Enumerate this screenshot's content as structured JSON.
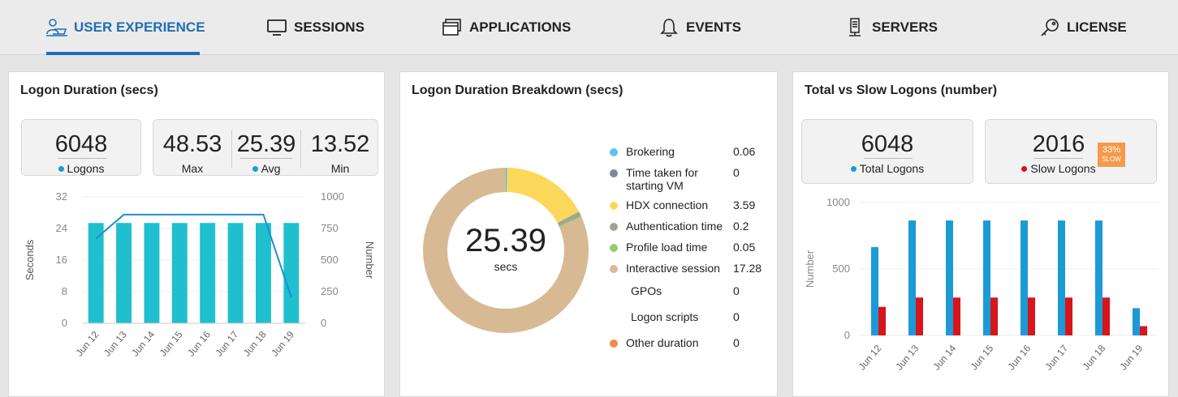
{
  "nav": {
    "tabs": [
      {
        "label": "USER EXPERIENCE",
        "icon": "user-laptop-icon",
        "active": true
      },
      {
        "label": "SESSIONS",
        "icon": "monitor-icon"
      },
      {
        "label": "APPLICATIONS",
        "icon": "windows-icon"
      },
      {
        "label": "EVENTS",
        "icon": "bell-icon"
      },
      {
        "label": "SERVERS",
        "icon": "server-icon"
      },
      {
        "label": "LICENSE",
        "icon": "key-icon"
      }
    ],
    "accent": "#1f6fb5"
  },
  "logon_duration": {
    "title": "Logon Duration (secs)",
    "logons_value": "6048",
    "logons_label": "Logons",
    "max_value": "48.53",
    "max_label": "Max",
    "avg_value": "25.39",
    "avg_label": "Avg",
    "min_value": "13.52",
    "min_label": "Min",
    "colors": {
      "bar": "#1fbfcf",
      "line": "#1b8fcf",
      "dot": "#1b9ad6"
    }
  },
  "breakdown": {
    "title": "Logon Duration Breakdown (secs)",
    "center_value": "25.39",
    "center_unit": "secs",
    "items": [
      {
        "label": "Brokering",
        "value": "0.06",
        "color": "#5bc2f0"
      },
      {
        "label": "Time taken for starting VM",
        "value": "0",
        "color": "#7d8a99"
      },
      {
        "label": "HDX connection",
        "value": "3.59",
        "color": "#fbd85a"
      },
      {
        "label": "Authentication time",
        "value": "0.2",
        "color": "#a3a394"
      },
      {
        "label": "Profile load time",
        "value": "0.05",
        "color": "#8fd16e"
      },
      {
        "label": "Interactive session",
        "value": "17.28",
        "color": "#d7ba94"
      },
      {
        "label": "GPOs",
        "value": "0",
        "color": ""
      },
      {
        "label": "Logon scripts",
        "value": "0",
        "color": ""
      },
      {
        "label": "Other duration",
        "value": "0",
        "color": "#f08a4b"
      }
    ]
  },
  "total_slow": {
    "title": "Total vs Slow Logons (number)",
    "total_value": "6048",
    "total_label": "Total Logons",
    "slow_value": "2016",
    "slow_label": "Slow Logons",
    "slow_pct": "33%",
    "slow_tag": "SLOW",
    "colors": {
      "total": "#1b9ad6",
      "slow": "#d8151b",
      "badge": "#f59a4c"
    }
  },
  "chart_data": [
    {
      "type": "bar",
      "categories": [
        "Jun 12",
        "Jun 13",
        "Jun 14",
        "Jun 15",
        "Jun 16",
        "Jun 17",
        "Jun 18",
        "Jun 19"
      ],
      "series": [
        {
          "values": [
            25.39,
            25.39,
            25.39,
            25.39,
            25.39,
            25.39,
            25.39,
            25.39
          ],
          "axis": "left",
          "kind": "bar"
        },
        {
          "values": [
            670,
            860,
            860,
            860,
            860,
            860,
            860,
            205
          ],
          "axis": "right",
          "kind": "line"
        }
      ],
      "ylabel": "Seconds",
      "y2label": "Number",
      "ylim": [
        0,
        32
      ],
      "y2lim": [
        0,
        1000
      ],
      "yticks": [
        "0",
        "8",
        "16",
        "24",
        "32"
      ],
      "y2ticks": [
        "0",
        "250",
        "500",
        "750",
        "1000"
      ],
      "grid": true
    },
    {
      "type": "pie",
      "categories": [
        "Brokering",
        "Time taken for starting VM",
        "HDX connection",
        "Authentication time",
        "Profile load time",
        "Interactive session",
        "GPOs",
        "Logon scripts",
        "Other duration"
      ],
      "values": [
        0.06,
        0,
        3.59,
        0.2,
        0.05,
        17.28,
        0,
        0,
        0
      ],
      "donut": true
    },
    {
      "type": "bar",
      "categories": [
        "Jun 12",
        "Jun 13",
        "Jun 14",
        "Jun 15",
        "Jun 16",
        "Jun 17",
        "Jun 18",
        "Jun 19"
      ],
      "series": [
        {
          "values": [
            665,
            865,
            865,
            865,
            865,
            865,
            865,
            205
          ]
        },
        {
          "values": [
            215,
            285,
            285,
            285,
            285,
            285,
            285,
            70
          ]
        }
      ],
      "ylabel": "Number",
      "ylim": [
        0,
        1000
      ],
      "yticks": [
        "0",
        "500",
        "1000"
      ],
      "grid": true
    }
  ]
}
